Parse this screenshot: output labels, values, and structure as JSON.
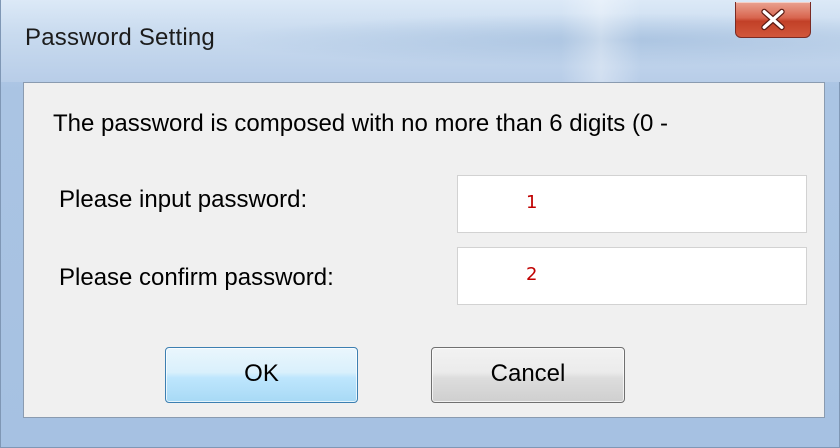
{
  "window": {
    "title": "Password Setting",
    "close_icon": "close-icon"
  },
  "dialog": {
    "message": "The password is composed with no more than 6 digits (0 -",
    "fields": [
      {
        "label": "Please input password:",
        "value": "1"
      },
      {
        "label": "Please confirm password:",
        "value": "2"
      }
    ],
    "buttons": {
      "ok_label": "OK",
      "cancel_label": "Cancel"
    }
  },
  "colors": {
    "close_button": "#c94a30",
    "field_value_text": "#c00000",
    "ok_button_border": "#3c7fb1"
  }
}
